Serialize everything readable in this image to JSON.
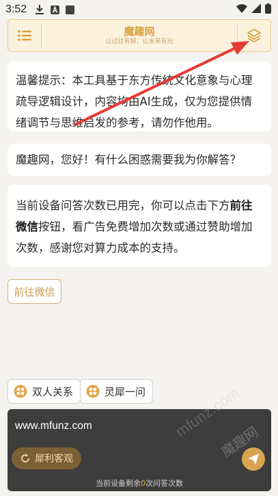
{
  "status_bar": {
    "time": "3:52"
  },
  "header": {
    "title": "魔趣网",
    "subtitle": "让过往有解，让未来有光"
  },
  "notice": {
    "text": "温馨提示：本工具基于东方传统文化意象与心理疏导逻辑设计，内容均由AI生成，仅为您提供情绪调节与思维启发的参考，请勿作他用。"
  },
  "greeting": {
    "text": "魔趣网，您好！有什么困惑需要我为你解答？"
  },
  "quota_message": {
    "part1": "当前设备问答次数已用完，你可以点击下方",
    "bold": "前往微信",
    "part2": "按钮，看广告免费增加次数或通过赞助增加次数，感谢您对算力成本的支持。"
  },
  "wechat_button": {
    "label": "前往微信"
  },
  "chips": [
    {
      "label": "双人关系"
    },
    {
      "label": "灵犀一问"
    }
  ],
  "input": {
    "value": "www.mfunz.com"
  },
  "objective_button": {
    "label": "犀利客观"
  },
  "quota_footer": {
    "prefix": "当前设备剩余",
    "count": "0",
    "suffix": "次问答次数"
  },
  "watermarks": {
    "large_text": "mfunz.com",
    "brand": "魔趣网"
  },
  "colors": {
    "accent": "#d9a451",
    "header_bg": "#fbf1dc",
    "arrow": "#e53935",
    "panel_bg": "#3d3d3d"
  }
}
